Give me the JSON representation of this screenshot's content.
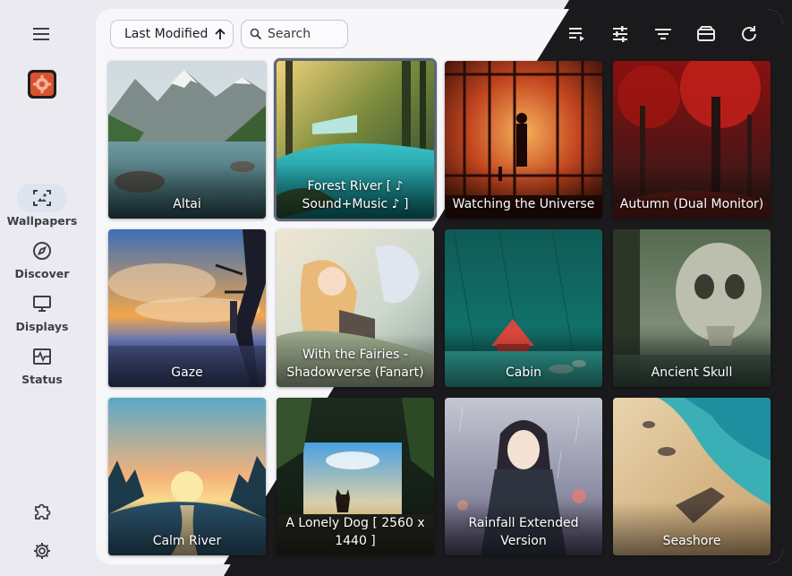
{
  "sidebar": {
    "menu_icon": "hamburger-menu-icon",
    "app_logo": "app-logo-icon",
    "items": [
      {
        "label": "Wallpapers",
        "icon": "wallpapers-icon",
        "active": true
      },
      {
        "label": "Discover",
        "icon": "compass-icon",
        "active": false
      },
      {
        "label": "Displays",
        "icon": "monitor-icon",
        "active": false
      },
      {
        "label": "Status",
        "icon": "status-pulse-icon",
        "active": false
      }
    ],
    "bottom": [
      {
        "icon": "puzzle-icon"
      },
      {
        "icon": "gear-icon"
      }
    ]
  },
  "toolbar": {
    "sort_label": "Last Modified",
    "sort_icon": "arrow-up-icon",
    "search_placeholder": "Search",
    "actions": [
      "playlist-icon",
      "sliders-icon",
      "filter-icon",
      "wallet-icon",
      "refresh-icon"
    ]
  },
  "wallpapers": [
    {
      "title": "Altai",
      "selected": false
    },
    {
      "title": "Forest River [ ♪ Sound+Music ♪ ]",
      "selected": true
    },
    {
      "title": "Watching the Universe",
      "selected": false
    },
    {
      "title": "Autumn (Dual Monitor)",
      "selected": false
    },
    {
      "title": "Gaze",
      "selected": false
    },
    {
      "title": "With the Fairies - Shadowverse (Fanart)",
      "selected": false
    },
    {
      "title": "Cabin",
      "selected": false
    },
    {
      "title": "Ancient Skull",
      "selected": false
    },
    {
      "title": "Calm River",
      "selected": false
    },
    {
      "title": "A Lonely Dog [ 2560 x 1440 ]",
      "selected": false
    },
    {
      "title": "Rainfall Extended Version",
      "selected": false
    },
    {
      "title": "Seashore",
      "selected": false
    }
  ],
  "colors": {
    "accent": "#dde3ef",
    "dark_background": "#1a1a1c",
    "light_background": "#f7f6f9"
  }
}
